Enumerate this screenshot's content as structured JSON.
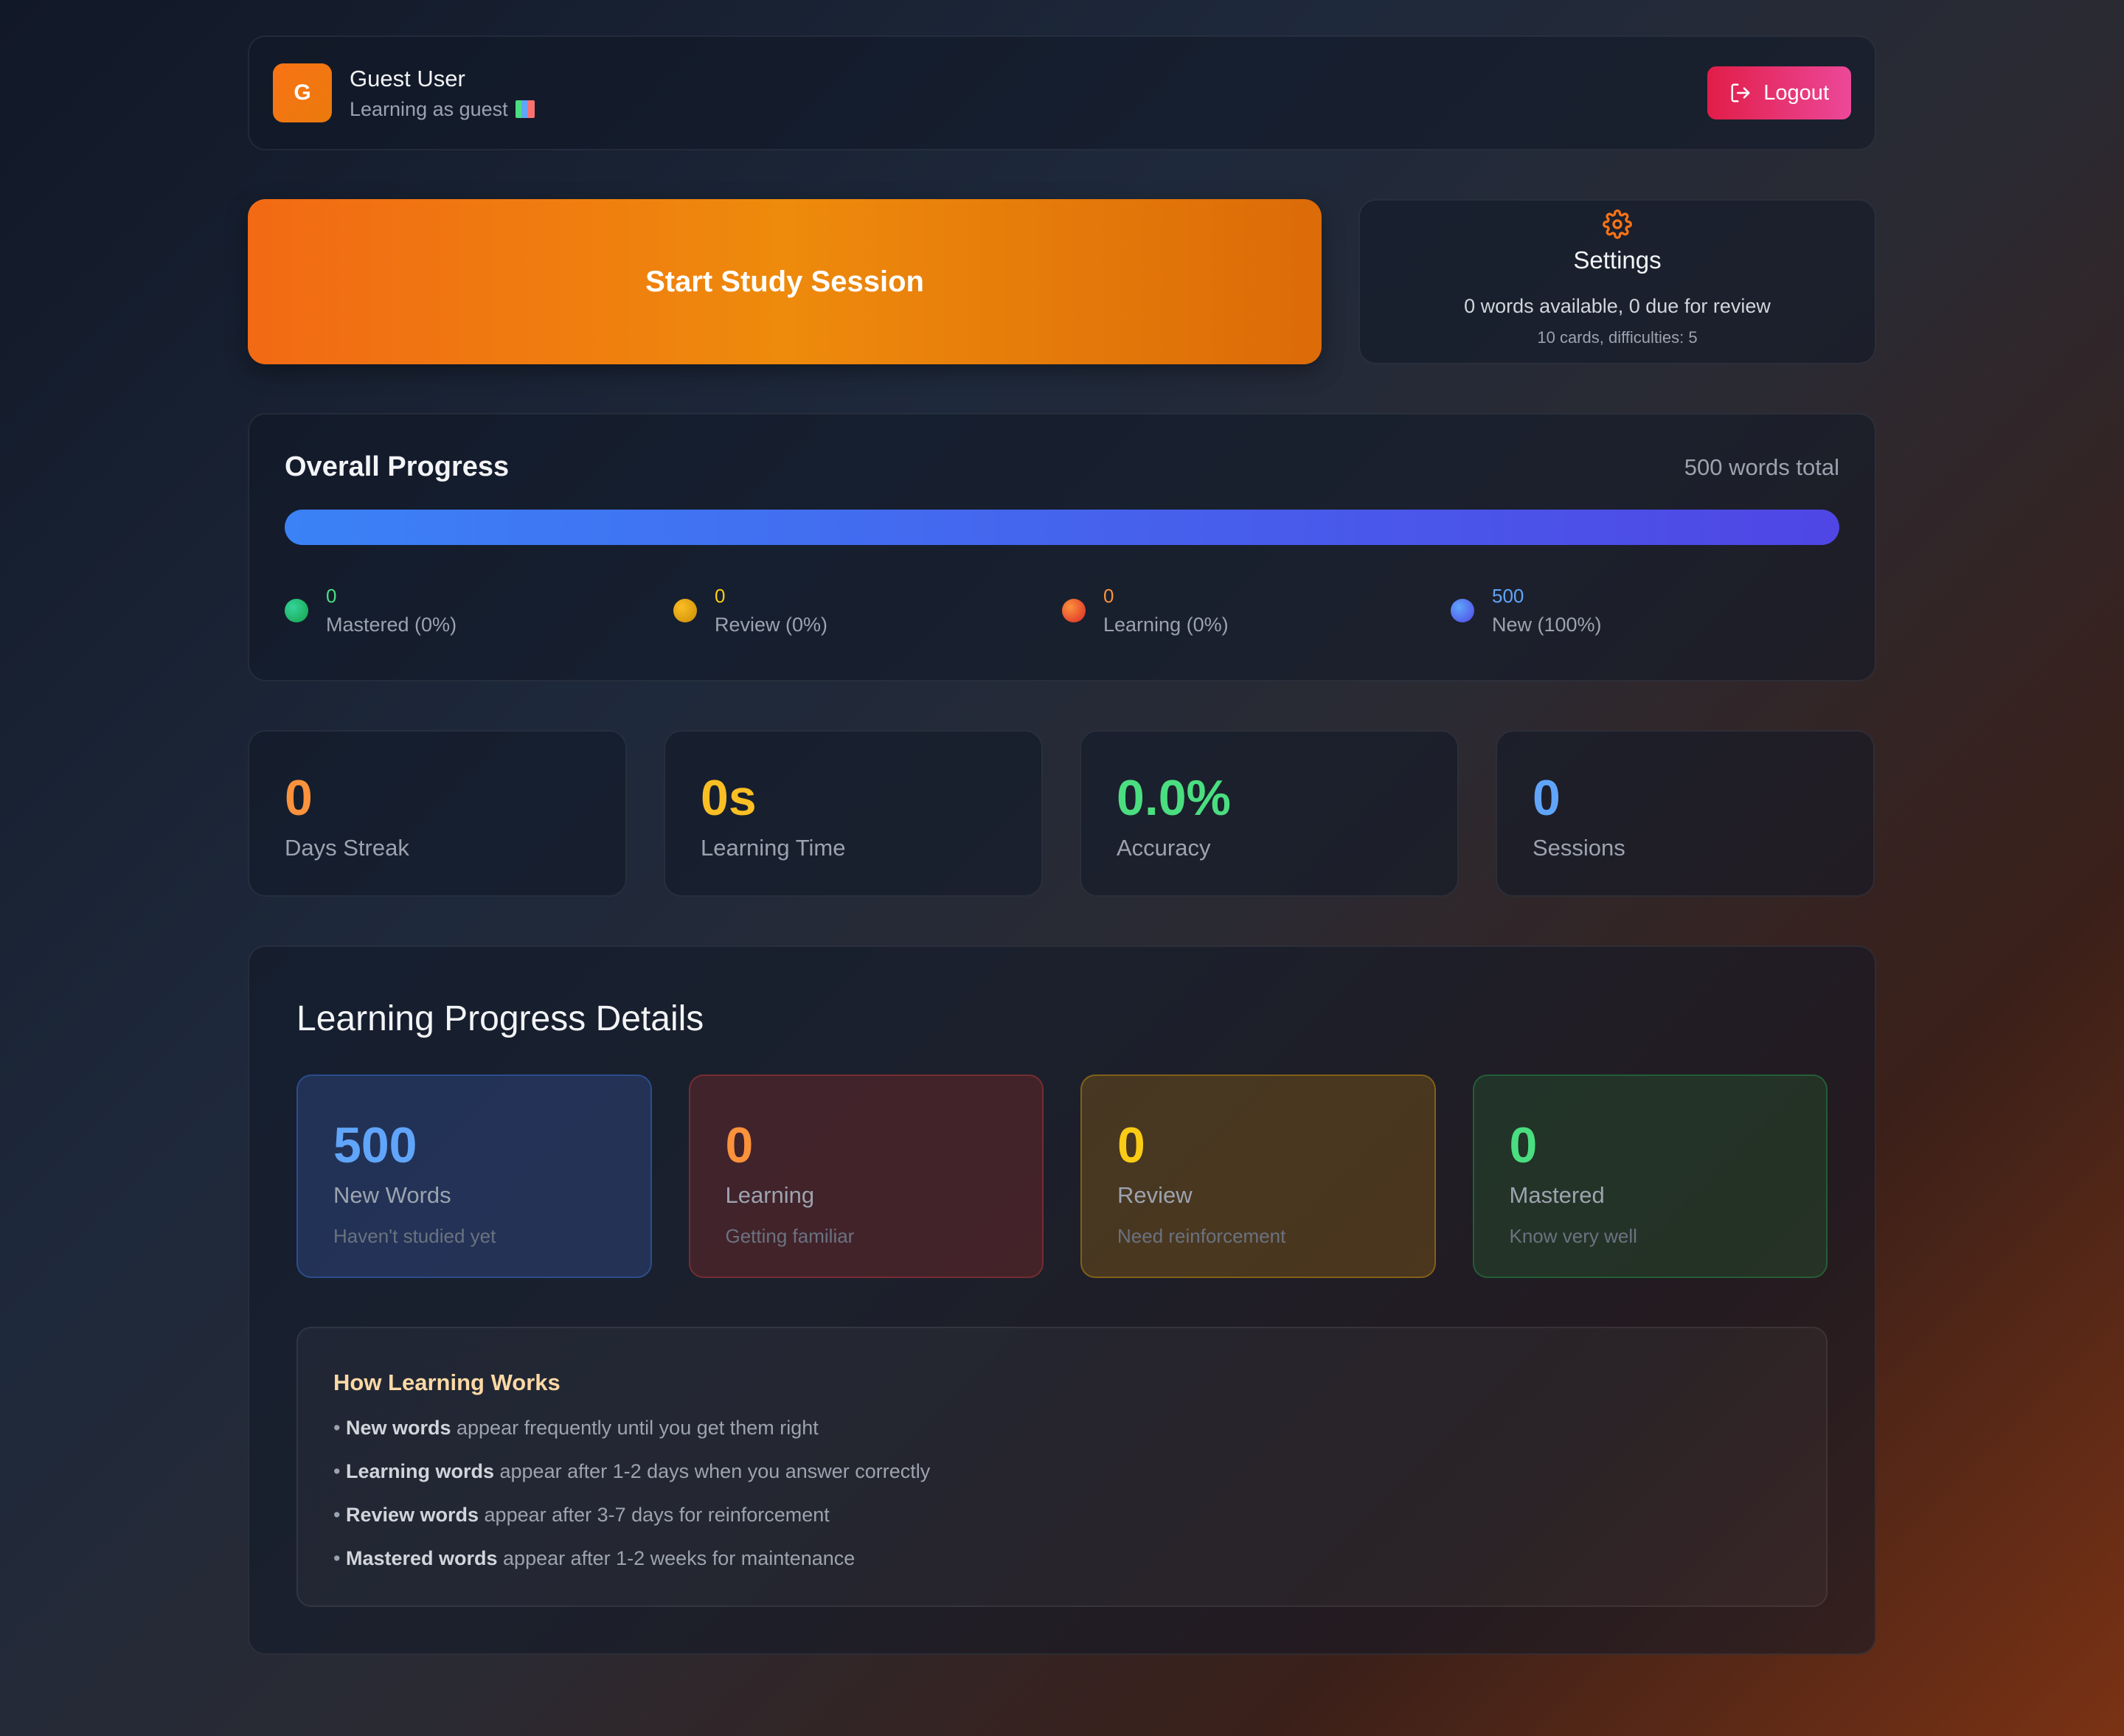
{
  "header": {
    "avatar_letter": "G",
    "user_name": "Guest User",
    "user_sub": "Learning as guest",
    "logout_label": "Logout"
  },
  "actions": {
    "start_label": "Start Study Session",
    "settings_title": "Settings",
    "settings_summary": "0 words available, 0 due for review",
    "settings_detail": "10 cards, difficulties: 5"
  },
  "overall": {
    "title": "Overall Progress",
    "total": "500 words total",
    "new_fraction": 1.0,
    "legend": [
      {
        "value": "0",
        "label": "Mastered (0%)",
        "color": "#22c55e"
      },
      {
        "value": "0",
        "label": "Review (0%)",
        "color": "#eab308"
      },
      {
        "value": "0",
        "label": "Learning (0%)",
        "color": "#f97316"
      },
      {
        "value": "500",
        "label": "New (100%)",
        "color": "#3b82f6"
      }
    ]
  },
  "stats": [
    {
      "value": "0",
      "label": "Days Streak",
      "color": "#fb923c"
    },
    {
      "value": "0s",
      "label": "Learning Time",
      "color": "#fbbf24"
    },
    {
      "value": "0.0%",
      "label": "Accuracy",
      "color": "#4ade80"
    },
    {
      "value": "0",
      "label": "Sessions",
      "color": "#60a5fa"
    }
  ],
  "details": {
    "title": "Learning Progress Details",
    "tiles": [
      {
        "value": "500",
        "label": "New Words",
        "sub": "Haven't studied yet",
        "color": "#60a5fa"
      },
      {
        "value": "0",
        "label": "Learning",
        "sub": "Getting familiar",
        "color": "#fb923c"
      },
      {
        "value": "0",
        "label": "Review",
        "sub": "Need reinforcement",
        "color": "#facc15"
      },
      {
        "value": "0",
        "label": "Mastered",
        "sub": "Know very well",
        "color": "#4ade80"
      }
    ],
    "how": {
      "title": "How Learning Works",
      "lines": [
        {
          "bold": "New words",
          "rest": " appear frequently until you get them right"
        },
        {
          "bold": "Learning words",
          "rest": " appear after 1-2 days when you answer correctly"
        },
        {
          "bold": "Review words",
          "rest": " appear after 3-7 days for reinforcement"
        },
        {
          "bold": "Mastered words",
          "rest": " appear after 1-2 weeks for maintenance"
        }
      ]
    }
  }
}
